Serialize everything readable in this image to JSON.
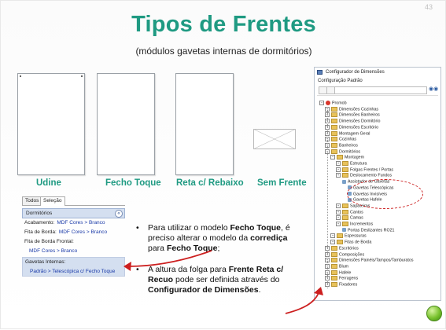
{
  "page_number": "43",
  "title": "Tipos de Frentes",
  "subtitle": "(módulos gavetas internas de dormitórios)",
  "front_types": [
    {
      "label": "Udine"
    },
    {
      "label": "Fecho Toque"
    },
    {
      "label": "Reta c/ Rebaixo"
    },
    {
      "label": "Sem Frente"
    }
  ],
  "panel": {
    "tabs": [
      "Todos",
      "Seleção"
    ],
    "section": "Dormitórios",
    "rows": {
      "acabamento_label": "Acabamento:",
      "acabamento_value": "MDF Cores > Branco",
      "fita_borda_label": "Fita de Borda:",
      "fita_borda_value": "MDF Cores > Branco",
      "fita_frontal_label": "Fita de Borda Frontal:",
      "fita_frontal_value": "MDF Cores > Branco",
      "gavetas_label": "Gavetas Internas:",
      "gavetas_value": "Padrão > Telescópica c/ Fecho Toque"
    }
  },
  "bullets": {
    "b1_a": "Para utilizar o modelo ",
    "b1_b": "Fecho Toque",
    "b1_c": ", é preciso alterar o modelo da ",
    "b1_d": "corrediça",
    "b1_e": " para ",
    "b1_f": "Fecho Toque",
    "b1_g": ";",
    "b2_a": "A altura da folga para ",
    "b2_b": "Frente Reta c/ Recuo",
    "b2_c": " pode ser definida através do ",
    "b2_d": "Configurador de Dimensões",
    "b2_e": "."
  },
  "dialog": {
    "title": "Configurador de Dimensões",
    "config": "Configuração Padrão",
    "tree": [
      "Promob",
      "Dimensões Cozinhas",
      "Dimensões Banheiros",
      "Dimensões Dormitório",
      "Dimensões Escritório",
      "Montagem Geral",
      "Cozinhas",
      "Banheiros",
      "Dormitórios",
      "Montagem",
      "Estrutura",
      "Folgas Frentes / Portas",
      "Deslocamento Fundos",
      "Assistador de Gavetas",
      "Gavetas Telescópicas",
      "Gavetas Invisíveis",
      "Gavetas Hafele",
      "Sapateiras",
      "Cantos",
      "Camas",
      "Incrementos",
      "Portas Deslizantes RO21",
      "Espessuras",
      "Fitas de Borda",
      "Escritórios",
      "Composições",
      "Dimensões Painéis/Tampos/Tamburatos",
      "Blum",
      "Hafele",
      "Ferragens",
      "Fixadores"
    ]
  },
  "colors": {
    "title": "#1f9a82",
    "arrow": "#cc1f1f",
    "link": "#1a3aa8"
  }
}
